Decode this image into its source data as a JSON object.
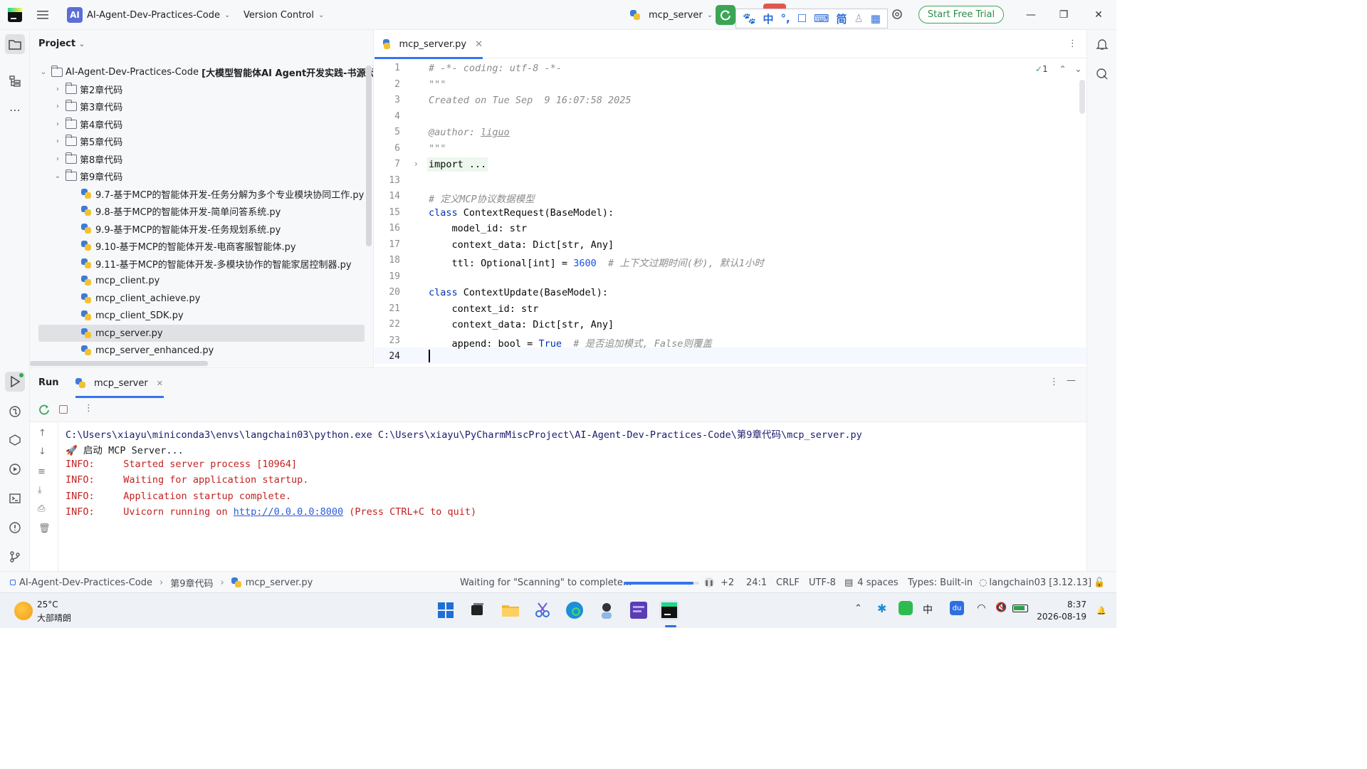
{
  "titlebar": {
    "badge": "AI",
    "project_name": "AI-Agent-Dev-Practices-Code",
    "vcs_label": "Version Control",
    "run_config": "mcp_server",
    "trial_label": "Start Free Trial",
    "ime_chars": [
      "中",
      "简"
    ]
  },
  "project_panel": {
    "header": "Project",
    "root_label": "AI-Agent-Dev-Practices-Code",
    "root_suffix": "[大模型智能体AI Agent开发实践-书源代码]",
    "folders": [
      "第2章代码",
      "第3章代码",
      "第4章代码",
      "第5章代码",
      "第8章代码",
      "第9章代码"
    ],
    "files": [
      "9.7-基于MCP的智能体开发-任务分解为多个专业模块协同工作.py",
      "9.8-基于MCP的智能体开发-简单问答系统.py",
      "9.9-基于MCP的智能体开发-任务规划系统.py",
      "9.10-基于MCP的智能体开发-电商客服智能体.py",
      "9.11-基于MCP的智能体开发-多模块协作的智能家居控制器.py",
      "mcp_client.py",
      "mcp_client_achieve.py",
      "mcp_client_SDK.py",
      "mcp_server.py",
      "mcp_server_enhanced.py"
    ]
  },
  "editor": {
    "tab_label": "mcp_server.py",
    "inspection_count": "1",
    "line_numbers": [
      "1",
      "2",
      "3",
      "4",
      "5",
      "6",
      "7",
      "13",
      "14",
      "15",
      "16",
      "17",
      "18",
      "19",
      "20",
      "21",
      "22",
      "23",
      "24"
    ],
    "lines": {
      "l1": "# -*- coding: utf-8 -*-",
      "l2": "\"\"\"",
      "l3": "Created on Tue Sep  9 16:07:58 2025",
      "l5a": "@author: ",
      "l5b": "liguo",
      "l6": "\"\"\"",
      "l7": "import ...",
      "l14": "# 定义MCP协议数据模型",
      "l15a": "class",
      "l15b": " ContextRequest(BaseModel):",
      "l16": "    model_id: str",
      "l17": "    context_data: Dict[str, Any]",
      "l18a": "    ttl: Optional[int] = ",
      "l18b": "3600",
      "l18c": "  # 上下文过期时间(秒), 默认1小时",
      "l20a": "class",
      "l20b": " ContextUpdate(BaseModel):",
      "l21": "    context_id: str",
      "l22": "    context_data: Dict[str, Any]",
      "l23a": "    append: bool = ",
      "l23b": "True",
      "l23c": "  # 是否追加模式, False则覆盖"
    }
  },
  "run_panel": {
    "title": "Run",
    "tab_label": "mcp_server",
    "cmd": "C:\\Users\\xiayu\\miniconda3\\envs\\langchain03\\python.exe C:\\Users\\xiayu\\PyCharmMiscProject\\AI-Agent-Dev-Practices-Code\\第9章代码\\mcp_server.py",
    "start_msg": "🚀 启动 MCP Server...",
    "info_prefix": "INFO:",
    "info1": "Started server process [10964]",
    "info2": "Waiting for application startup.",
    "info3": "Application startup complete.",
    "info4a": "Uvicorn running on ",
    "info4_link": "http://0.0.0.0:8000",
    "info4b": " (Press CTRL+C to quit)"
  },
  "statusbar": {
    "crumb_root": "AI-Agent-Dev-Practices-Code",
    "crumb_folder": "第9章代码",
    "crumb_file": "mcp_server.py",
    "task": "Waiting for \"Scanning\" to complete...",
    "task_progress": 0.92,
    "extra": "+2",
    "position": "24:1",
    "line_sep": "CRLF",
    "encoding": "UTF-8",
    "indent": "4 spaces",
    "types": "Types: Built-in",
    "interpreter": "langchain03 [3.12.13]"
  },
  "taskbar": {
    "temp": "25°C",
    "weather": "大部晴朗",
    "ime": "中",
    "time": "8:37",
    "date": "2026-08-19"
  },
  "colors": {
    "accent": "#3574f0",
    "run_green": "#3aa655",
    "info_red": "#c22222",
    "keyword": "#0033b3",
    "comment": "#8c8c8c"
  }
}
